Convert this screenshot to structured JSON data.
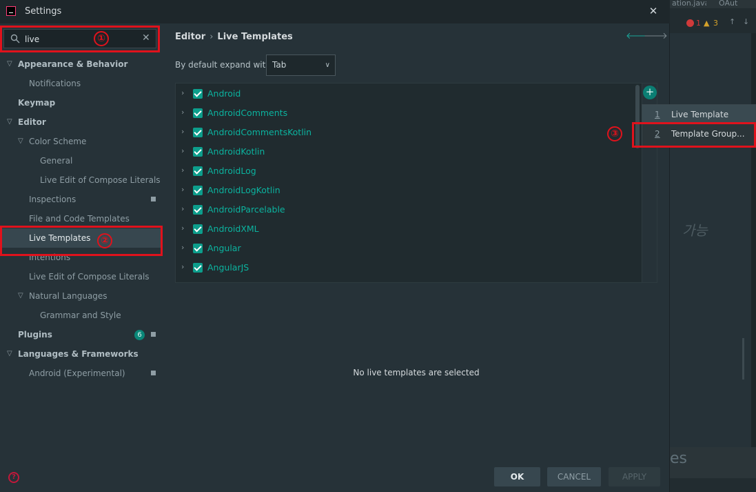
{
  "dialog": {
    "title": "Settings",
    "close_label": "✕"
  },
  "search": {
    "value": "live",
    "clear_label": "✕"
  },
  "tree": [
    {
      "label": "Appearance & Behavior",
      "expanded": true
    },
    {
      "label": "Notifications"
    },
    {
      "label": "Keymap"
    },
    {
      "label": "Editor",
      "expanded": true
    },
    {
      "label": "Color Scheme",
      "expanded": true
    },
    {
      "label": "General"
    },
    {
      "label": "Live Edit of Compose Literals"
    },
    {
      "label": "Inspections"
    },
    {
      "label": "File and Code Templates"
    },
    {
      "label": "Live Templates",
      "selected": true
    },
    {
      "label": "Intentions"
    },
    {
      "label": "Live Edit of Compose Literals"
    },
    {
      "label": "Natural Languages",
      "expanded": true
    },
    {
      "label": "Grammar and Style"
    },
    {
      "label": "Plugins",
      "badge": "6"
    },
    {
      "label": "Languages & Frameworks",
      "expanded": true
    },
    {
      "label": "Android (Experimental)"
    }
  ],
  "breadcrumb": {
    "root": "Editor",
    "sep": "›",
    "current": "Live Templates"
  },
  "expand": {
    "label": "By default expand with",
    "value": "Tab"
  },
  "template_groups": [
    "Android",
    "AndroidComments",
    "AndroidCommentsKotlin",
    "AndroidKotlin",
    "AndroidLog",
    "AndroidLogKotlin",
    "AndroidParcelable",
    "AndroidXML",
    "Angular",
    "AngularJS"
  ],
  "empty_message": "No live templates are selected",
  "buttons": {
    "ok": "OK",
    "cancel": "CANCEL",
    "apply": "APPLY"
  },
  "add_menu": [
    {
      "num": "1",
      "label": "Live Template"
    },
    {
      "num": "2",
      "label": "Template Group..."
    }
  ],
  "annotations": [
    "①",
    "②",
    "③"
  ],
  "background_ide": {
    "tabs": [
      "ation.java",
      "OAut"
    ],
    "inspections": {
      "errors": "1",
      "warnings": "3"
    },
    "bottom_text": "es",
    "korean_text": "가능"
  },
  "colors": {
    "accent": "#0bb39f",
    "annotation_red": "#e0121c",
    "dialog_bg": "#263238"
  }
}
